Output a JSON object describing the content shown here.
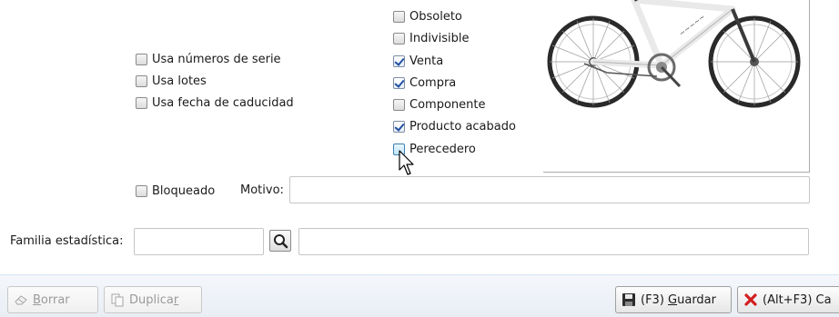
{
  "checkboxes_left": [
    {
      "label": "Usa números de serie",
      "checked": false
    },
    {
      "label": "Usa lotes",
      "checked": false
    },
    {
      "label": "Usa fecha de caducidad",
      "checked": false
    }
  ],
  "checkboxes_right": [
    {
      "label": "Obsoleto",
      "checked": false
    },
    {
      "label": "Indivisible",
      "checked": false
    },
    {
      "label": "Venta",
      "checked": true
    },
    {
      "label": "Compra",
      "checked": true
    },
    {
      "label": "Componente",
      "checked": false
    },
    {
      "label": "Producto acabado",
      "checked": true
    },
    {
      "label": "Perecedero",
      "checked": false
    }
  ],
  "blocked": {
    "label": "Bloqueado",
    "checked": false
  },
  "motivo": {
    "label": "Motivo:",
    "value": ""
  },
  "familia": {
    "label": "Familia estadística:",
    "code": "",
    "description": ""
  },
  "footer": {
    "delete_prefix": "B",
    "delete_rest": "orrar",
    "duplicate_prefix": "Duplica",
    "duplicate_ul": "r",
    "save_prefix": "(F3) ",
    "save_ul": "G",
    "save_rest": "uardar",
    "cancel_text": "(Alt+F3) Ca"
  }
}
